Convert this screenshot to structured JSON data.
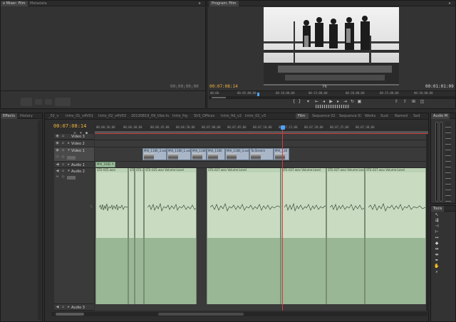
{
  "source_monitor": {
    "tabs": [
      "o Mixer: Film",
      "Metadata"
    ],
    "timecode": "00;00;00;00"
  },
  "program_monitor": {
    "tab": "Program: Film",
    "timecode_current": "00:07:08:14",
    "timecode_duration": "00:01:01:09",
    "fit_label": "Fit",
    "ruler": [
      "00;00",
      "00:05;00;00",
      "00:10;00;00",
      "00:15;00;00",
      "00:20;00;00",
      "00:25;00;00",
      "00:30;00;00",
      "00:35;00;00"
    ]
  },
  "effects_panel": {
    "tabs": [
      "Effects",
      "History"
    ]
  },
  "timeline": {
    "sequence_tabs": [
      "_02_v",
      "Intro_01_v4V01",
      "Intro_02_v4V03",
      "20130819_09_Ubo-ha...",
      "Intro_frg",
      "ShS_Offices",
      "Intro_fid_v2",
      "Intro_02_v3",
      "Film",
      "Sequence 02",
      "Sequence 01",
      "Works",
      "Sust",
      "Named",
      "Sed"
    ],
    "active_tab": "Film",
    "timecode": "00:07:08:14",
    "ruler": [
      "00;00;36;00",
      "00;06;40;00",
      "00;06;45;00",
      "00;06;50;00",
      "00;07;00;00",
      "00;07;05;00",
      "00;07;10;00",
      "00;07;15;00",
      "00;07;20;00",
      "00;07;25;00",
      "00;07;30;00"
    ],
    "tracks": {
      "video3": "Video 3",
      "video2": "Video 2",
      "video1": "Video 1",
      "audio1": "Audio 1",
      "audio2": "Audio 2",
      "audio3": "Audio 3"
    },
    "video_clips": [
      {
        "label": "MVI_1180_3.avi"
      },
      {
        "label": "MVI_1180_1.avi"
      },
      {
        "label": "MVI_118C"
      },
      {
        "label": "MVI_1180"
      },
      {
        "label": "MVI_1180_3.avi"
      },
      {
        "label": "To:Stretch"
      },
      {
        "label": "MVI_118"
      }
    ],
    "audio1_clip": "MVI_1082.A",
    "audio_clips": [
      {
        "label": "STE-025.wav"
      },
      {
        "label": "STE-"
      },
      {
        "label": "STE-2"
      },
      {
        "label": "STE-025.wav Volume:Level"
      },
      {
        "label": "STE-027.wav Volume:Level"
      },
      {
        "label": "STE-027.wav Volume:Level"
      },
      {
        "label": "STE-027.wav Volume:Level"
      },
      {
        "label": "STE-027.wav Volume:Level"
      }
    ]
  },
  "audio_meters": {
    "tab": "Audio M"
  },
  "tools": {
    "tab": "Tools",
    "items": [
      "selection-tool",
      "track-select-tool",
      "ripple-edit-tool",
      "rolling-edit-tool",
      "rate-stretch-tool",
      "razor-tool",
      "slip-tool",
      "slide-tool",
      "pen-tool",
      "hand-tool",
      "zoom-tool"
    ]
  }
}
